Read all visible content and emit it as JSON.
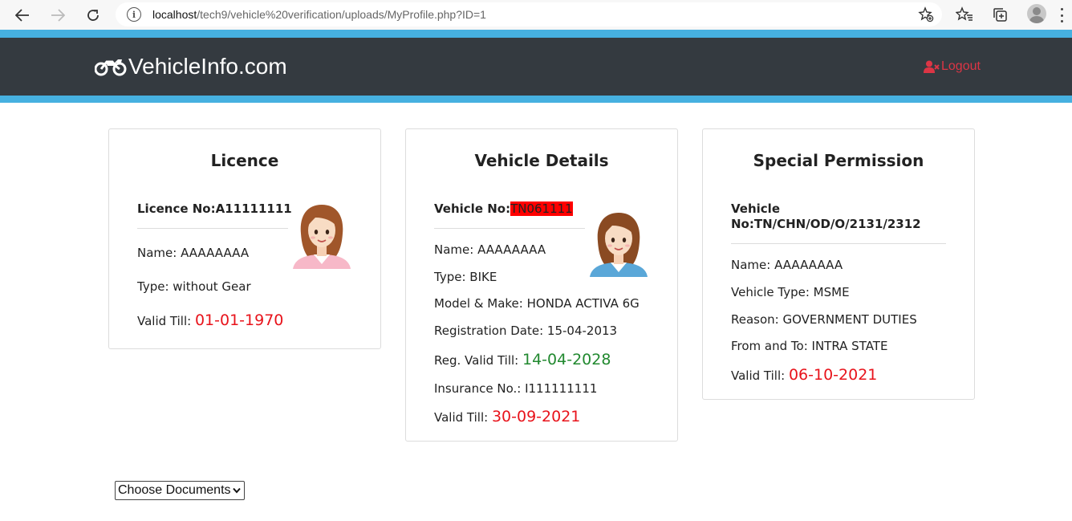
{
  "browser": {
    "url_host": "localhost",
    "url_path": "/tech9/vehicle%20verification/uploads/MyProfile.php?ID=1"
  },
  "header": {
    "brand": "VehicleInfo.com",
    "logout_label": "Logout"
  },
  "licence": {
    "title": "Licence",
    "licence_no": "Licence No:A11111111",
    "name": "Name: AAAAAAAA",
    "type": "Type: without Gear",
    "valid_label": "Valid Till:",
    "valid_date": "01-01-1970"
  },
  "vehicle": {
    "title": "Vehicle Details",
    "vehicle_no_label": "Vehicle No:",
    "vehicle_no": "TN061111",
    "name": "Name: AAAAAAAA",
    "type": "Type: BIKE",
    "model": "Model & Make: HONDA ACTIVA 6G",
    "registration": "Registration Date: 15-04-2013",
    "reg_valid_label": "Reg. Valid Till:",
    "reg_valid_date": "14-04-2028",
    "insurance": "Insurance No.: I111111111",
    "valid_label": "Valid Till:",
    "valid_date": "30-09-2021"
  },
  "permission": {
    "title": "Special Permission",
    "vehicle_no_line1": "Vehicle",
    "vehicle_no_line2": "No:TN/CHN/OD/O/2131/2312",
    "name": "Name: AAAAAAAA",
    "vehicle_type": "Vehicle Type: MSME",
    "reason": "Reason: GOVERNMENT DUTIES",
    "from_to": "From and To: INTRA STATE",
    "valid_label": "Valid Till:",
    "valid_date": "06-10-2021"
  },
  "documents": {
    "selected": "Choose Documents"
  },
  "colors": {
    "header_bg": "#343a40",
    "stripe": "#46b0e0",
    "expired": "#e8131b",
    "valid": "#21892f",
    "logout": "#dc3545"
  }
}
